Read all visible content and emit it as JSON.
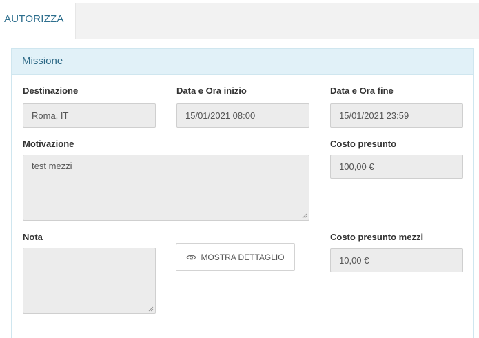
{
  "tabs": {
    "active_label": "AUTORIZZA"
  },
  "panel": {
    "title": "Missione"
  },
  "fields": {
    "destinazione": {
      "label": "Destinazione",
      "value": "Roma, IT"
    },
    "data_inizio": {
      "label": "Data e Ora inizio",
      "value": "15/01/2021 08:00"
    },
    "data_fine": {
      "label": "Data e Ora fine",
      "value": "15/01/2021 23:59"
    },
    "motivazione": {
      "label": "Motivazione",
      "value": "test mezzi"
    },
    "costo_presunto": {
      "label": "Costo presunto",
      "value": "100,00 €"
    },
    "nota": {
      "label": "Nota",
      "value": ""
    },
    "costo_mezzi": {
      "label": "Costo presunto mezzi",
      "value": "10,00 €"
    }
  },
  "buttons": {
    "mostra_dettaglio": "MOSTRA DETTAGLIO"
  },
  "icons": {
    "mostra_dettaglio": "eye-icon",
    "resize": "resize-grip-icon"
  },
  "colors": {
    "accent": "#2e6f8e",
    "panel_header_bg": "#e1f1f8",
    "field_bg": "#ececec"
  }
}
